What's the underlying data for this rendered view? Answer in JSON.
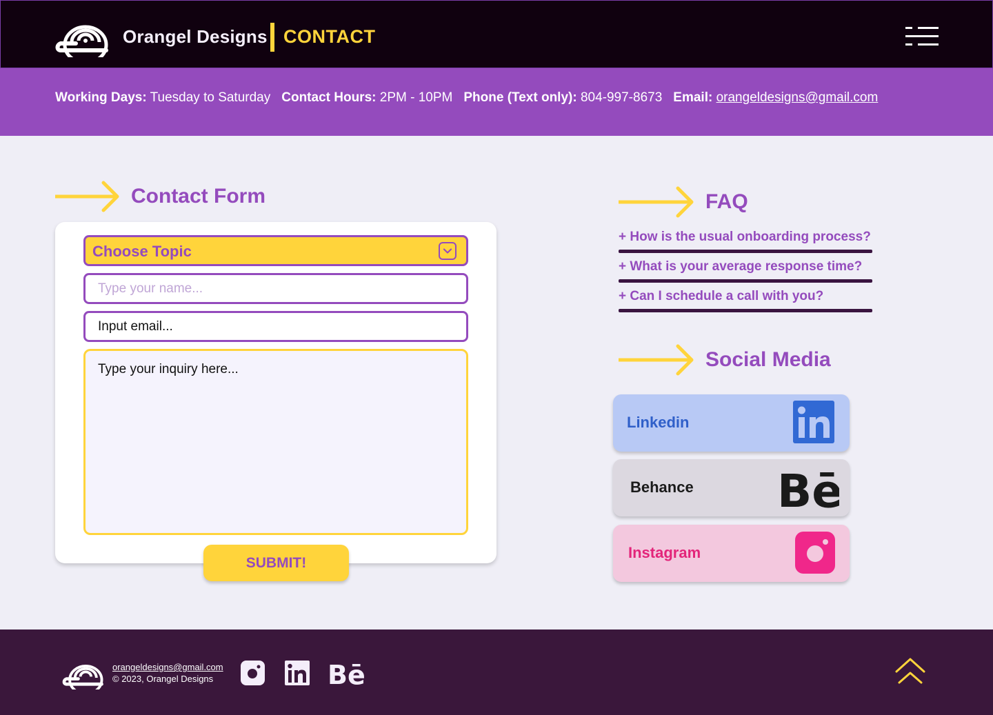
{
  "header": {
    "brand": "Orangel Designs",
    "page_label": "CONTACT"
  },
  "info": {
    "working_days_label": "Working Days:",
    "working_days": "Tuesday to Saturday",
    "contact_hours_label": "Contact Hours:",
    "contact_hours": "2PM - 10PM",
    "phone_label": "Phone (Text only):",
    "phone": "804-997-8673",
    "email_label": "Email:",
    "email": "orangeldesigns@gmail.com"
  },
  "contact_form": {
    "title": "Contact Form",
    "topic_label": "Choose Topic",
    "name_placeholder": "Type your name...",
    "email_placeholder": "Input email...",
    "inquiry_placeholder": "Type your inquiry here...",
    "submit_label": "SUBMIT!"
  },
  "faq": {
    "title": "FAQ",
    "items": [
      "+ How is the usual onboarding process?",
      "+ What is your average response time?",
      "+ Can I schedule a call with you?"
    ]
  },
  "social": {
    "title": "Social Media",
    "items": [
      {
        "name": "Linkedin",
        "bg": "#b8c9f5",
        "text_color": "#2f5fc9"
      },
      {
        "name": "Behance",
        "bg": "#dcd8e0",
        "text_color": "#1a1a1a"
      },
      {
        "name": "Instagram",
        "bg": "#f3c8de",
        "text_color": "#e3257a"
      }
    ]
  },
  "footer": {
    "email": "orangeldesigns@gmail.com",
    "copyright": "© 2023, Orangel Designs"
  },
  "colors": {
    "purple": "#944bbd",
    "yellow": "#ffd43b",
    "dark": "#10010f",
    "footer_bg": "#3a173b"
  }
}
